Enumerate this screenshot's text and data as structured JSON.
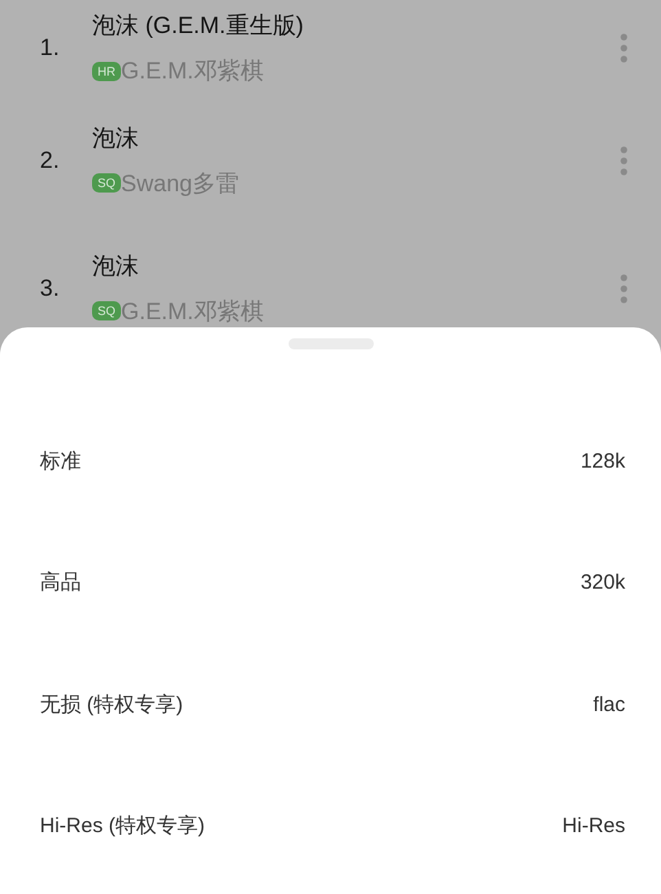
{
  "songs": [
    {
      "number": "1.",
      "title": "泡沫 (G.E.M.重生版)",
      "badge": "HR",
      "artist": "G.E.M.邓紫棋"
    },
    {
      "number": "2.",
      "title": "泡沫",
      "badge": "SQ",
      "artist": "Swang多雷"
    },
    {
      "number": "3.",
      "title": "泡沫",
      "badge": "SQ",
      "artist": "G.E.M.邓紫棋"
    }
  ],
  "quality_sheet": {
    "options": [
      {
        "label": "标准",
        "value": "128k"
      },
      {
        "label": "高品",
        "value": "320k"
      },
      {
        "label": "无损 (特权专享)",
        "value": "flac"
      },
      {
        "label": "Hi-Res (特权专享)",
        "value": "Hi-Res"
      }
    ]
  }
}
